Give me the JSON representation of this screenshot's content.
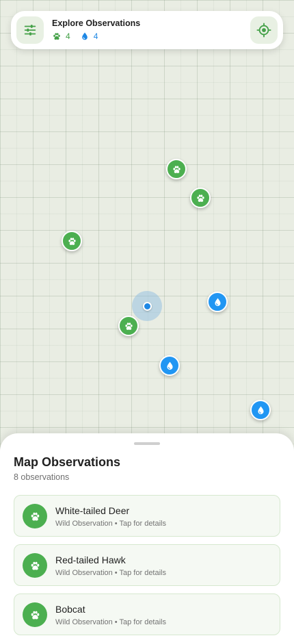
{
  "header": {
    "title": "Explore Observations",
    "wild_count": "4",
    "water_count": "4",
    "filter_icon": "tune-icon",
    "locate_icon": "my-location-icon",
    "wild_icon": "paw-icon",
    "water_icon": "water-drop-icon"
  },
  "colors": {
    "wild": "#4caf50",
    "water": "#2196f3",
    "accent": "#43a047",
    "map_background": "#e9ede3"
  },
  "sheet": {
    "title": "Map Observations",
    "subtitle": "8 observations",
    "items": [
      {
        "title": "White-tailed Deer",
        "subtitle": "Wild Observation • Tap for details",
        "icon": "paw-icon"
      },
      {
        "title": "Red-tailed Hawk",
        "subtitle": "Wild Observation • Tap for details",
        "icon": "paw-icon"
      },
      {
        "title": "Bobcat",
        "subtitle": "Wild Observation • Tap for details",
        "icon": "paw-icon"
      }
    ]
  }
}
